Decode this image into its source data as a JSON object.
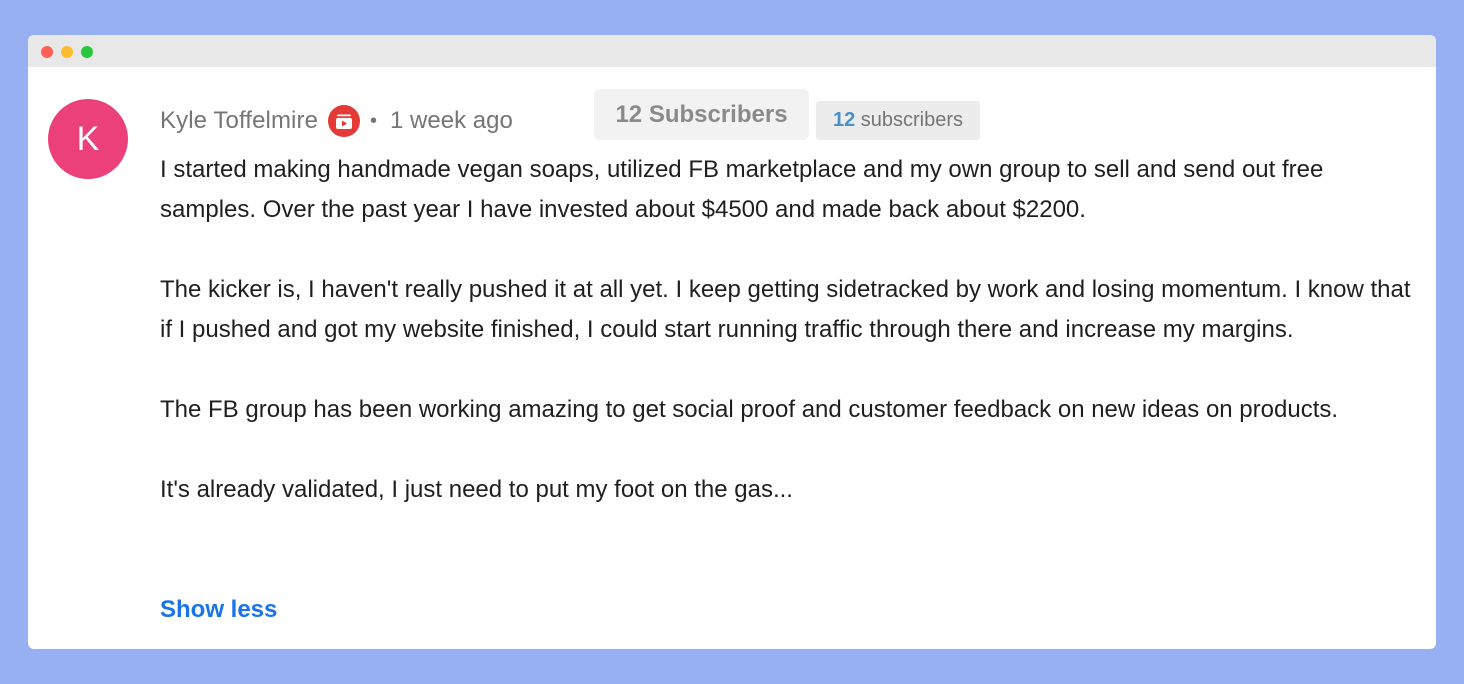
{
  "comment": {
    "avatar_letter": "K",
    "author": "Kyle Toffelmire",
    "badge_icon": "creator-badge-icon",
    "separator": "•",
    "time": "1 week ago",
    "subscriber_chip": "12 Subscribers",
    "subscriber_pill": {
      "count": "12",
      "label": "subscribers"
    },
    "paragraphs": [
      "I started making handmade vegan soaps, utilized FB marketplace and my own group to sell and send out free samples. Over the past year I have invested about  $4500 and made back about $2200.",
      "The kicker is, I haven't really pushed it at all yet. I keep getting sidetracked by work and losing momentum. I know that if I pushed and got my website finished, I could start running traffic through there and increase my margins.",
      "The FB group has been working amazing to get social proof and customer feedback on new ideas on products.",
      "It's already validated, I just need to put my foot on the gas..."
    ],
    "show_less": "Show less"
  },
  "colors": {
    "background": "#97b0f1",
    "avatar": "#ec407a",
    "badge": "#e53935",
    "link": "#1a73e8",
    "pill_number": "#4a90c9"
  }
}
